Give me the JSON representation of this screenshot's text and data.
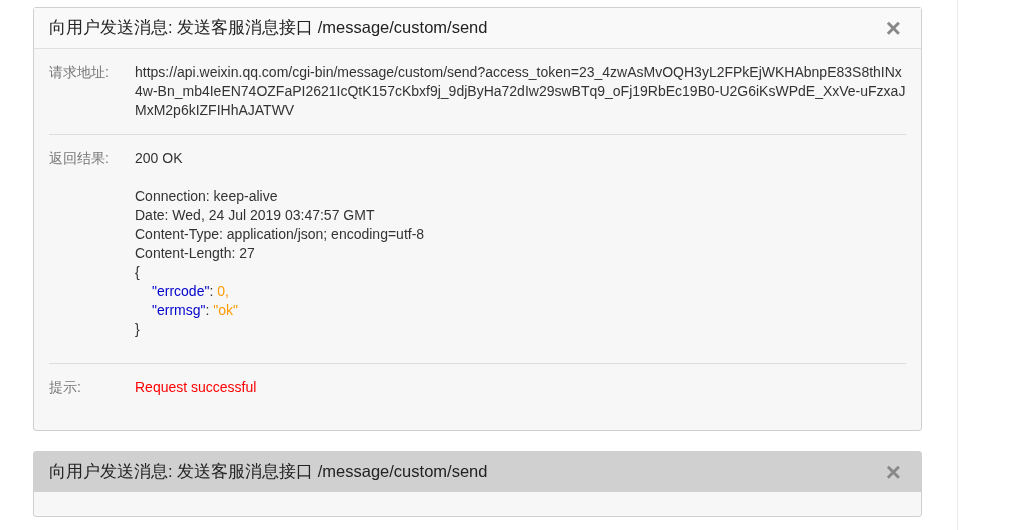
{
  "panels": [
    {
      "title": "向用户发送消息: 发送客服消息接口 /message/custom/send",
      "close": "×",
      "expanded": true,
      "rows": [
        {
          "kind": "url",
          "label": "请求地址:",
          "value": "https://api.weixin.qq.com/cgi-bin/message/custom/send?access_token=23_4zwAsMvOQH3yL2FPkEjWKHAbnpE83S8thINx4w-Bn_mb4IeEN74OZFaPI2621IcQtK157cKbxf9j_9djByHa72dIw29swBTq9_oFj19RbEc19B0-U2G6iKsWPdE_XxVe-uFzxaJMxM2p6kIZFIHhAJATWV"
        },
        {
          "kind": "response",
          "label": "返回结果:",
          "status": "200 OK",
          "headers": [
            "Connection: keep-alive",
            "Date: Wed, 24 Jul 2019 03:47:57 GMT",
            "Content-Type: application/json; encoding=utf-8",
            "Content-Length: 27"
          ],
          "body": [
            {
              "kind": "brace",
              "text": "{"
            },
            {
              "kind": "pair",
              "key": "\"errcode\"",
              "sep": ":",
              "value": "0,"
            },
            {
              "kind": "pair",
              "key": "\"errmsg\"",
              "sep": ":",
              "value": "\"ok\""
            },
            {
              "kind": "brace",
              "text": "}"
            }
          ]
        },
        {
          "kind": "notice",
          "label": "提示:",
          "value": "Request successful"
        }
      ]
    },
    {
      "title": "向用户发送消息: 发送客服消息接口 /message/custom/send",
      "close": "×",
      "expanded": false
    }
  ]
}
